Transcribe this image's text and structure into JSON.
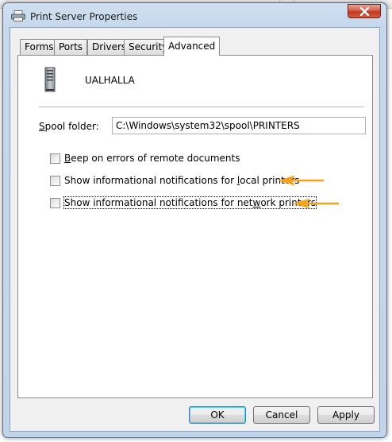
{
  "window": {
    "title": "Print Server Properties",
    "close_icon": "close-icon"
  },
  "tabs": [
    {
      "label": "Forms",
      "active": false
    },
    {
      "label": "Ports",
      "active": false
    },
    {
      "label": "Drivers",
      "active": false
    },
    {
      "label": "Security",
      "active": false
    },
    {
      "label": "Advanced",
      "active": true
    }
  ],
  "advanced": {
    "server_name": "UALHALLA",
    "spool_label_key": "S",
    "spool_label_rest": "pool folder:",
    "spool_folder_value": "C:\\Windows\\system32\\spool\\PRINTERS",
    "options": [
      {
        "pre": "",
        "key": "B",
        "post": "eep on errors of remote documents",
        "checked": false
      },
      {
        "pre": "Show informational notifications for ",
        "key": "l",
        "post": "ocal printers",
        "checked": false
      },
      {
        "pre": "Show informational notifications for net",
        "key": "w",
        "post": "ork printers",
        "checked": false
      }
    ]
  },
  "buttons": {
    "ok": "OK",
    "cancel": "Cancel",
    "apply": "Apply"
  },
  "colors": {
    "annotation_arrow": "#f5a31a",
    "title_bar": "#c6d8ec",
    "close_button": "#c23a21"
  }
}
